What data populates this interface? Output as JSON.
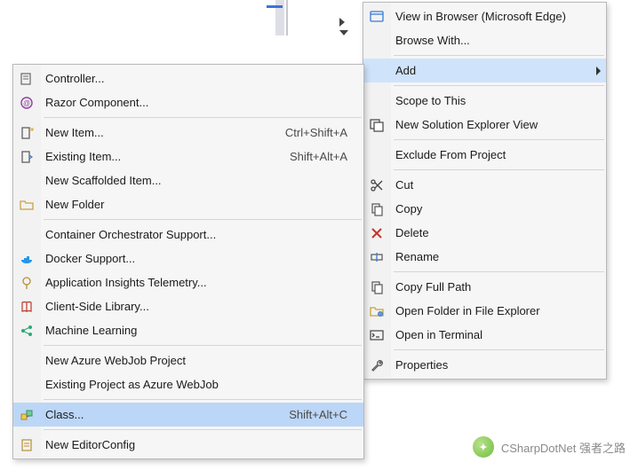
{
  "context_menu": {
    "groups": [
      [
        {
          "id": "view-in-browser",
          "label": "View in Browser (Microsoft Edge)",
          "icon": "browser-icon"
        },
        {
          "id": "browse-with",
          "label": "Browse With..."
        }
      ],
      [
        {
          "id": "add",
          "label": "Add",
          "submenu": true,
          "highlight": true
        }
      ],
      [
        {
          "id": "scope-to-this",
          "label": "Scope to This"
        },
        {
          "id": "new-solution-explorer-view",
          "label": "New Solution Explorer View",
          "icon": "new-view-icon"
        }
      ],
      [
        {
          "id": "exclude-from-project",
          "label": "Exclude From Project"
        }
      ],
      [
        {
          "id": "cut",
          "label": "Cut",
          "icon": "scissors-icon"
        },
        {
          "id": "copy",
          "label": "Copy",
          "icon": "copy-icon"
        },
        {
          "id": "delete",
          "label": "Delete",
          "icon": "delete-icon"
        },
        {
          "id": "rename",
          "label": "Rename",
          "icon": "rename-icon"
        }
      ],
      [
        {
          "id": "copy-full-path",
          "label": "Copy Full Path",
          "icon": "copy-icon"
        },
        {
          "id": "open-in-file-explorer",
          "label": "Open Folder in File Explorer",
          "icon": "folder-open-icon"
        },
        {
          "id": "open-in-terminal",
          "label": "Open in Terminal",
          "icon": "terminal-icon"
        }
      ],
      [
        {
          "id": "properties",
          "label": "Properties",
          "icon": "wrench-icon"
        }
      ]
    ]
  },
  "add_submenu": {
    "groups": [
      [
        {
          "id": "controller",
          "label": "Controller...",
          "icon": "controller-icon"
        },
        {
          "id": "razor-component",
          "label": "Razor Component...",
          "icon": "razor-icon"
        }
      ],
      [
        {
          "id": "new-item",
          "label": "New Item...",
          "shortcut": "Ctrl+Shift+A",
          "icon": "new-item-icon"
        },
        {
          "id": "existing-item",
          "label": "Existing Item...",
          "shortcut": "Shift+Alt+A",
          "icon": "existing-item-icon"
        },
        {
          "id": "new-scaffolded-item",
          "label": "New Scaffolded Item..."
        },
        {
          "id": "new-folder",
          "label": "New Folder",
          "icon": "folder-icon"
        }
      ],
      [
        {
          "id": "container-orchestrator",
          "label": "Container Orchestrator Support..."
        },
        {
          "id": "docker-support",
          "label": "Docker Support...",
          "icon": "docker-icon"
        },
        {
          "id": "app-insights",
          "label": "Application Insights Telemetry...",
          "icon": "insights-icon"
        },
        {
          "id": "client-side-lib",
          "label": "Client-Side Library...",
          "icon": "library-icon"
        },
        {
          "id": "machine-learning",
          "label": "Machine Learning",
          "icon": "ml-icon"
        }
      ],
      [
        {
          "id": "new-azure-webjob",
          "label": "New Azure WebJob Project"
        },
        {
          "id": "existing-azure-webjob",
          "label": "Existing Project as Azure WebJob"
        }
      ],
      [
        {
          "id": "class",
          "label": "Class...",
          "shortcut": "Shift+Alt+C",
          "icon": "class-icon",
          "highlight": true
        }
      ],
      [
        {
          "id": "new-editorconfig",
          "label": "New EditorConfig",
          "icon": "editorconfig-icon"
        }
      ]
    ]
  },
  "watermark": {
    "text": "CSharpDotNet 强者之路"
  }
}
